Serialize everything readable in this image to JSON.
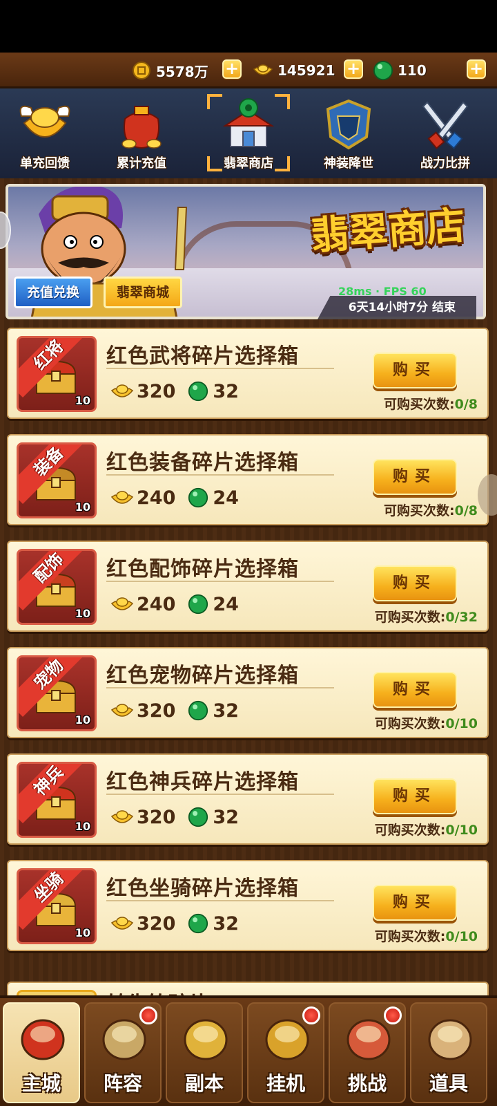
{
  "currency": {
    "coins": "5578万",
    "ingots": "145921",
    "jade": "110"
  },
  "tabs": [
    {
      "label": "单充回馈",
      "icon": "gold-ingot-wings-icon"
    },
    {
      "label": "累计充值",
      "icon": "treasure-bag-icon"
    },
    {
      "label": "翡翠商店",
      "icon": "jade-shop-icon",
      "selected": true
    },
    {
      "label": "神装降世",
      "icon": "divine-armor-icon"
    },
    {
      "label": "战力比拼",
      "icon": "crossed-swords-icon"
    }
  ],
  "banner": {
    "title": "翡翠商店",
    "exchange_button": "充值兑换",
    "mall_button": "翡翠商城",
    "network": "28ms · FPS 60",
    "countdown": "6天14小时7分 结束"
  },
  "items": [
    {
      "name": "红色武将碎片选择箱",
      "ribbon": "红将",
      "qty": "10",
      "price_ingot": "320",
      "price_jade": "32",
      "buy": "购买",
      "limit_label": "可购买次数:",
      "limit_value": "0/8"
    },
    {
      "name": "红色装备碎片选择箱",
      "ribbon": "装备",
      "qty": "10",
      "price_ingot": "240",
      "price_jade": "24",
      "buy": "购买",
      "limit_label": "可购买次数:",
      "limit_value": "0/8"
    },
    {
      "name": "红色配饰碎片选择箱",
      "ribbon": "配饰",
      "qty": "10",
      "price_ingot": "240",
      "price_jade": "24",
      "buy": "购买",
      "limit_label": "可购买次数:",
      "limit_value": "0/32"
    },
    {
      "name": "红色宠物碎片选择箱",
      "ribbon": "宠物",
      "qty": "10",
      "price_ingot": "320",
      "price_jade": "32",
      "buy": "购买",
      "limit_label": "可购买次数:",
      "limit_value": "0/10"
    },
    {
      "name": "红色神兵碎片选择箱",
      "ribbon": "神兵",
      "qty": "10",
      "price_ingot": "320",
      "price_jade": "32",
      "buy": "购买",
      "limit_label": "可购买次数:",
      "limit_value": "0/10"
    },
    {
      "name": "红色坐骑碎片选择箱",
      "ribbon": "坐骑",
      "qty": "10",
      "price_ingot": "320",
      "price_jade": "32",
      "buy": "购买",
      "limit_label": "可购买次数:",
      "limit_value": "0/10"
    }
  ],
  "partial_item": {
    "name": "转生符碎片"
  },
  "nav": [
    {
      "label": "主城",
      "active": true,
      "dot": false
    },
    {
      "label": "阵容",
      "active": false,
      "dot": true
    },
    {
      "label": "副本",
      "active": false,
      "dot": false
    },
    {
      "label": "挂机",
      "active": false,
      "dot": true
    },
    {
      "label": "挑战",
      "active": false,
      "dot": true
    },
    {
      "label": "道具",
      "active": false,
      "dot": false
    }
  ]
}
